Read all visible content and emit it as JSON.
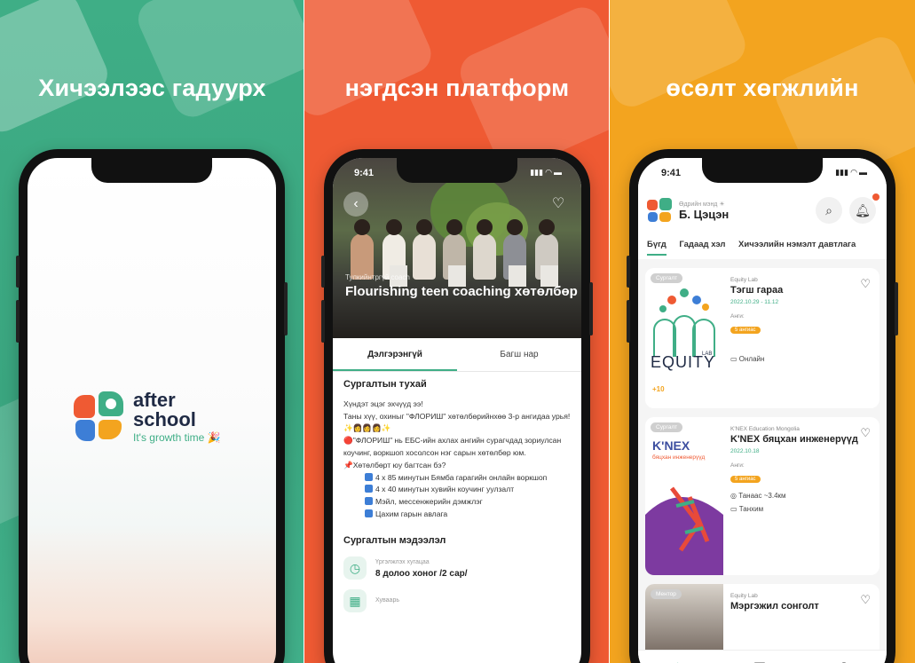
{
  "panels": {
    "p1": {
      "headline": "Хичээлээс гадуурх",
      "bg": "#3fae86"
    },
    "p2": {
      "headline": "нэгдсэн платформ",
      "bg": "#ef5a33"
    },
    "p3": {
      "headline": "өсөлт хөгжлийн",
      "bg": "#f3a41f"
    }
  },
  "splash": {
    "logo_word1": "after",
    "logo_word2": "school",
    "tagline": "It's growth time",
    "tagline_emoji": "🎉"
  },
  "detail": {
    "time": "9:41",
    "back_icon": "‹",
    "heart_icon": "♡",
    "category": "Тулкийнтргүй coach",
    "title": "Flourishing teen coaching хөтөлбөр",
    "tabs": [
      "Дэлгэрэнгүй",
      "Багш нар"
    ],
    "section_about": "Сургалтын тухай",
    "about_lines": [
      "Хүндэт эцэг эхчүүд ээ!",
      "Таны хүү, охиныг \"ФЛОРИШ\" хөтөлбөрийнхөө 3-р ангидаа урья! ✨👩👩👩✨",
      "🔴\"ФЛОРИШ\" нь ЕБС-ийн ахлах ангийн сурагчдад зориулсан коучинг, воркшоп хосолсон нэг сарын хөтөлбөр юм.",
      "📌Хөтөлбөрт юу багтсан бэ?"
    ],
    "about_items": [
      "4 х 85 минутын Бямба гарагийн онлайн воркшоп",
      "4 х 40 минутын хувийн коучинг уулзалт",
      "Мэйл, мессенжерийн дэмжлэг",
      "Цахим гарын авлага"
    ],
    "section_info": "Сургалтын мэдээлэл",
    "duration_label": "Үргэлжлэх хугацаа",
    "duration_value": "8 долоо хоног /2 сар/",
    "schedule_label": "Хуваарь"
  },
  "home": {
    "time": "9:41",
    "greeting": "Өдрийн мэнд ☀",
    "user_name": "Б. Цэцэн",
    "search_icon": "search-icon",
    "bell_icon": "bell-icon",
    "categories": [
      "Бүгд",
      "Гадаад хэл",
      "Хичээлийн нэмэлт давтлага"
    ],
    "cards": [
      {
        "tag": "Сургалт",
        "org": "Equity Lab",
        "title": "Тэгш гараа",
        "dates": "2022.10.29 - 11.12",
        "age_label": "Анги:",
        "age_pill": "5 ангиас",
        "meta1": "Онлайн",
        "thumb_word": "EQUITY",
        "thumb_sub": "LAB",
        "points": "+10"
      },
      {
        "tag": "Сургалт",
        "org": "K'NEX Education Mongolia",
        "title": "K'NEX бяцхан инженерүүд",
        "dates": "2022.10.18",
        "age_label": "Анги:",
        "age_pill": "5 ангиас",
        "meta1": "Танаас ~3.4км",
        "meta2": "Танхим",
        "thumb_word": "K'NEX",
        "thumb_sub": "бяцхан инженерүүд"
      },
      {
        "tag": "Ментор",
        "org": "Equity Lab",
        "title": "Мэргэжил сонголт"
      }
    ],
    "nav": [
      "home-icon",
      "chart-icon",
      "user-icon"
    ]
  }
}
